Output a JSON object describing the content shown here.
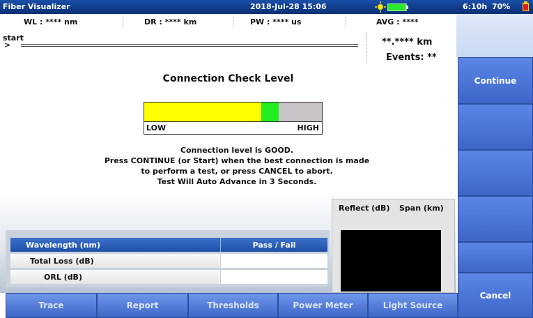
{
  "status_bar": {
    "app_title": "Fiber Visualizer",
    "datetime": "2018-Jul-28 15:06",
    "battery_time": "6:10h",
    "battery_percent": "70%"
  },
  "info_bar": {
    "wl": "WL : **** nm",
    "dr": "DR : **** km",
    "pw": "PW : **** us",
    "avg": "AVG : ****"
  },
  "trace": {
    "start_label": "start",
    "distance": "**.**** km",
    "events": "Events: **"
  },
  "connection": {
    "heading": "Connection Check Level",
    "low_label": "LOW",
    "high_label": "HIGH",
    "level_fraction": 0.66,
    "message_lines": [
      "Connection level is GOOD.",
      "Press CONTINUE (or Start) when the best connection is made",
      "to perform a test, or press CANCEL to abort.",
      "Test Will Auto Advance in 3 Seconds."
    ]
  },
  "results_table": {
    "header_left": "Wavelength (nm)",
    "header_right": "Pass / Fail",
    "row1_label": "Total Loss (dB)",
    "row2_label": "ORL (dB)"
  },
  "reflect_panel": {
    "reflect_label": "Reflect (dB)",
    "span_label": "Span (km)"
  },
  "side_buttons": {
    "continue": "Continue",
    "cancel": "Cancel"
  },
  "bottom_tabs": [
    "Trace",
    "Report",
    "Thresholds",
    "Power Meter",
    "Light Source"
  ],
  "colors": {
    "level_yellow": "#ffff00",
    "level_green": "#22ee22",
    "table_header": "#2b5fb8",
    "button_blue": "#4a74d6"
  }
}
